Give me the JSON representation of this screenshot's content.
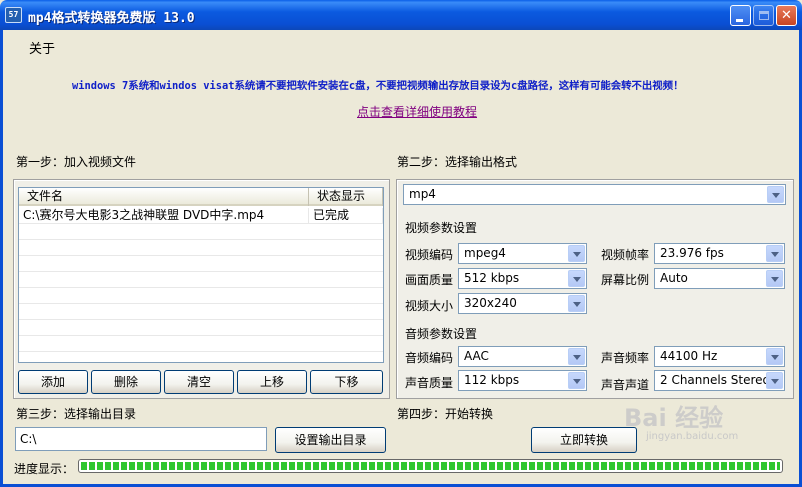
{
  "window": {
    "title": "mp4格式转换器免费版 13.0",
    "app_icon": "57"
  },
  "about": "关于",
  "warning": "windows 7系统和windos visat系统请不要把软件安装在c盘，不要把视频输出存放目录设为c盘路径，这样有可能会转不出视频！",
  "tutorial_link": "点击查看详细使用教程",
  "step1": {
    "label": "第一步：加入视频文件",
    "columns": [
      "文件名",
      "状态显示"
    ],
    "rows": [
      {
        "name": "C:\\赛尔号大电影3之战神联盟 DVD中字.mp4",
        "status": "已完成"
      }
    ],
    "buttons": [
      "添加",
      "删除",
      "清空",
      "上移",
      "下移"
    ]
  },
  "step2": {
    "label": "第二步：选择输出格式",
    "format": "mp4",
    "video_section": "视频参数设置",
    "video": {
      "codec_label": "视频编码",
      "codec": "mpeg4",
      "framerate_label": "视频帧率",
      "framerate": "23.976 fps",
      "quality_label": "画面质量",
      "quality": "512 kbps",
      "aspect_label": "屏幕比例",
      "aspect": "Auto",
      "size_label": "视频大小",
      "size": "320x240"
    },
    "audio_section": "音频参数设置",
    "audio": {
      "codec_label": "音频编码",
      "codec": "AAC",
      "samplerate_label": "声音频率",
      "samplerate": "44100 Hz",
      "quality_label": "声音质量",
      "quality": "112 kbps",
      "channels_label": "声音声道",
      "channels": "2 Channels Stereo"
    }
  },
  "step3": {
    "label": "第三步：选择输出目录",
    "path": "C:\\",
    "set_button": "设置输出目录"
  },
  "step4": {
    "label": "第四步：开始转换",
    "convert_button": "立即转换"
  },
  "progress": {
    "label": "进度显示：",
    "value": 1.0
  },
  "watermark": {
    "text": "Bai 经验",
    "sub": "jingyan.baidu.com"
  }
}
